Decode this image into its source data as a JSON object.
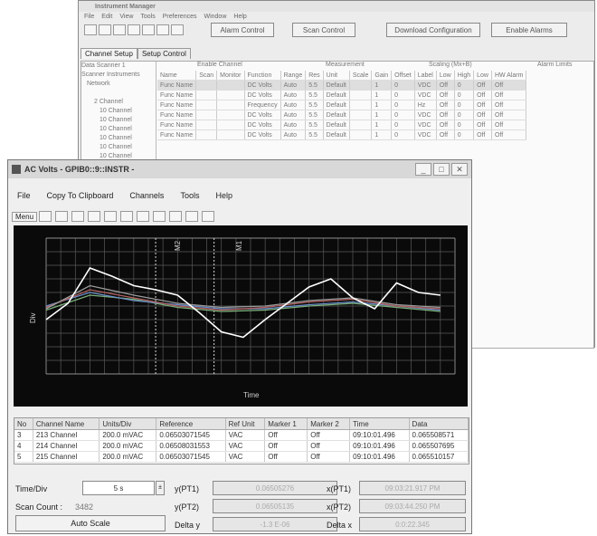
{
  "bg_window": {
    "title": "Instrument Manager",
    "menu": [
      "File",
      "Edit",
      "View",
      "Tools",
      "Preferences",
      "Window",
      "Help"
    ],
    "toolbar_buttons": [
      "Alarm Control",
      "Scan Control",
      "Download Configuration",
      "Enable Alarms"
    ],
    "tabs": [
      "Channel Setup",
      "Setup Control"
    ],
    "tree": [
      "Data Scanner 1",
      "Scanner Instruments",
      "Network",
      "2 Channel",
      "10 Channel",
      "10 Channel",
      "10 Channel",
      "10 Channel",
      "10 Channel",
      "10 Channel"
    ],
    "group_headers": [
      "Enable Channel",
      "Measurement",
      "Scaling (Mx+B)",
      "Alarm Limits"
    ],
    "columns": [
      "Name",
      "Scan",
      "Monitor",
      "Function",
      "Range",
      "Res",
      "Unit",
      "Scale",
      "Gain",
      "Offset",
      "Label",
      "Low",
      "High",
      "Low",
      "HW Alarm"
    ],
    "rows": [
      [
        "Func Name",
        "",
        "",
        "DC Volts",
        "Auto",
        "5.5",
        "Default",
        "",
        "1",
        "0",
        "VDC",
        "Off",
        "0",
        "Off",
        "Off"
      ],
      [
        "Func Name",
        "",
        "",
        "DC Volts",
        "Auto",
        "5.5",
        "Default",
        "",
        "1",
        "0",
        "VDC",
        "Off",
        "0",
        "Off",
        "Off"
      ],
      [
        "Func Name",
        "",
        "",
        "Frequency",
        "Auto",
        "5.5",
        "Default",
        "",
        "1",
        "0",
        "Hz",
        "Off",
        "0",
        "Off",
        "Off"
      ],
      [
        "Func Name",
        "",
        "",
        "DC Volts",
        "Auto",
        "5.5",
        "Default",
        "",
        "1",
        "0",
        "VDC",
        "Off",
        "0",
        "Off",
        "Off"
      ],
      [
        "Func Name",
        "",
        "",
        "DC Volts",
        "Auto",
        "5.5",
        "Default",
        "",
        "1",
        "0",
        "VDC",
        "Off",
        "0",
        "Off",
        "Off"
      ],
      [
        "Func Name",
        "",
        "",
        "DC Volts",
        "Auto",
        "5.5",
        "Default",
        "",
        "1",
        "0",
        "VDC",
        "Off",
        "0",
        "Off",
        "Off"
      ]
    ]
  },
  "main_window": {
    "title": "AC Volts - GPIB0::9::INSTR -",
    "menu": [
      "File",
      "Copy To Clipboard",
      "Channels",
      "Tools",
      "Help"
    ],
    "toolbar_first_label": "Menu",
    "chart_label_top_1": "M2",
    "chart_label_top_2": "M1",
    "y_axis_label": "Div",
    "x_axis_label": "Time",
    "marker_columns": [
      "No",
      "Channel Name",
      "Units/Div",
      "Reference",
      "Ref Unit",
      "Marker 1",
      "Marker 2",
      "Time",
      "Data"
    ],
    "marker_rows": [
      [
        "3",
        "213 Channel",
        "200.0 mVAC",
        "0.06503071545",
        "VAC",
        "Off",
        "Off",
        "09:10:01.496",
        "0.065508571"
      ],
      [
        "4",
        "214 Channel",
        "200.0 mVAC",
        "0.06508031553",
        "VAC",
        "Off",
        "Off",
        "09:10:01.496",
        "0.065507695"
      ],
      [
        "5",
        "215 Channel",
        "200.0 mVAC",
        "0.06503071545",
        "VAC",
        "Off",
        "Off",
        "09:10:01.496",
        "0.065510157"
      ]
    ],
    "time_div_label": "Time/Div",
    "time_div_value": "5 s",
    "scan_count_label": "Scan Count :",
    "scan_count_value": "3482",
    "auto_scale_label": "Auto Scale",
    "y1_label": "y(PT1)",
    "y1_value": "0.06505276",
    "y2_label": "y(PT2)",
    "y2_value": "0.06505135",
    "delta_y_label": "Delta y",
    "delta_y_value": "-1.3 E-06",
    "x1_label": "x(PT1)",
    "x1_value": "09:03:21.917 PM",
    "x2_label": "x(PT2)",
    "x2_value": "09:03:44.250 PM",
    "delta_x_label": "Delta x",
    "delta_x_value": "0:0:22.345"
  },
  "chart_data": {
    "type": "line",
    "title": "",
    "xlabel": "Time",
    "ylabel": "Div",
    "grid": true,
    "x_divisions": 28,
    "y_divisions": 10,
    "xlim": [
      0,
      28
    ],
    "ylim": [
      0,
      10
    ],
    "series": [
      {
        "color": "#ffffff",
        "x": [
          0,
          1.5,
          3,
          4.5,
          6,
          7.5,
          9,
          10.5,
          12,
          13.5,
          15,
          16.5,
          18,
          19.5,
          21,
          22.5,
          24,
          25.5,
          27
        ],
        "y": [
          4.0,
          5.2,
          7.8,
          7.2,
          6.5,
          6.2,
          5.8,
          4.5,
          3.1,
          2.7,
          4.0,
          5.2,
          6.4,
          7.0,
          5.6,
          4.8,
          6.7,
          6.0,
          5.8
        ]
      },
      {
        "color": "#9a9a9a",
        "x": [
          0,
          3,
          6,
          9,
          12,
          15,
          18,
          21,
          24,
          27
        ],
        "y": [
          4.8,
          6.5,
          5.8,
          5.2,
          4.9,
          5.0,
          5.4,
          5.6,
          5.1,
          4.9
        ]
      },
      {
        "color": "#b06060",
        "x": [
          0,
          3,
          6,
          9,
          12,
          15,
          18,
          21,
          24,
          27
        ],
        "y": [
          4.9,
          6.2,
          5.6,
          5.0,
          4.7,
          4.9,
          5.3,
          5.5,
          5.0,
          4.8
        ]
      },
      {
        "color": "#6a8cc6",
        "x": [
          0,
          3,
          6,
          9,
          12,
          15,
          18,
          21,
          24,
          27
        ],
        "y": [
          5.0,
          6.0,
          5.4,
          5.1,
          4.8,
          4.8,
          5.1,
          5.3,
          5.0,
          4.7
        ]
      },
      {
        "color": "#7ab07a",
        "x": [
          0,
          3,
          6,
          9,
          12,
          15,
          18,
          21,
          24,
          27
        ],
        "y": [
          4.7,
          5.8,
          5.5,
          4.9,
          4.6,
          4.7,
          5.0,
          5.2,
          4.9,
          4.6
        ]
      }
    ]
  }
}
